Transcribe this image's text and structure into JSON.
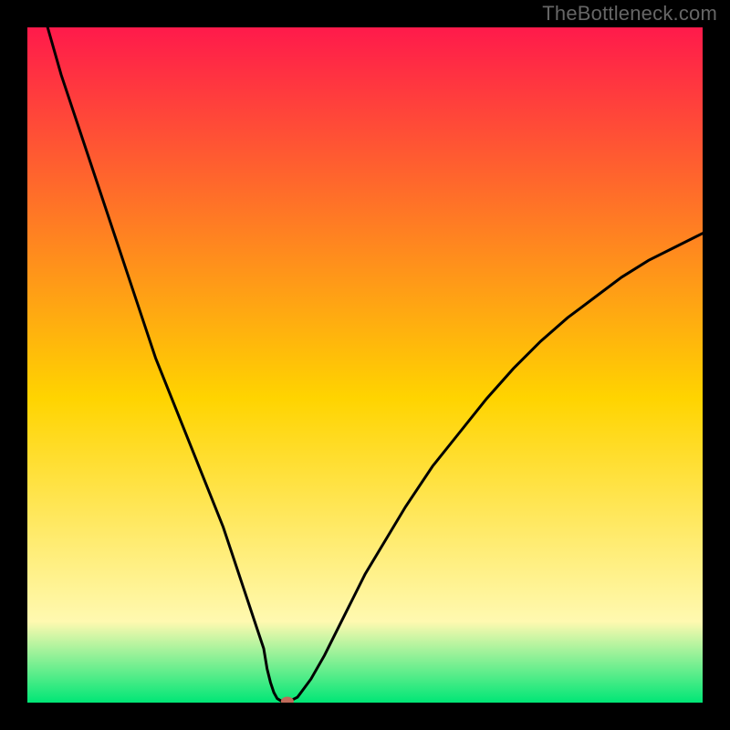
{
  "watermark": "TheBottleneck.com",
  "chart_data": {
    "type": "line",
    "title": "",
    "xlabel": "",
    "ylabel": "",
    "xlim": [
      0,
      100
    ],
    "ylim": [
      0,
      100
    ],
    "background_gradient": {
      "top_color": "#ff1a4b",
      "mid_color": "#ffd400",
      "lower_color": "#fff9b0",
      "bottom_color": "#00e676"
    },
    "series": [
      {
        "name": "bottleneck-curve",
        "color": "#000000",
        "x": [
          3,
          5,
          7,
          9,
          11,
          13,
          15,
          17,
          19,
          21,
          23,
          25,
          27,
          29,
          30,
          31,
          32,
          33,
          34,
          35,
          35.5,
          36,
          36.5,
          37,
          37.5,
          38,
          38.5,
          39,
          40,
          42,
          44,
          46,
          48,
          50,
          53,
          56,
          60,
          64,
          68,
          72,
          76,
          80,
          84,
          88,
          92,
          96,
          100
        ],
        "y": [
          100,
          93,
          87,
          81,
          75,
          69,
          63,
          57,
          51,
          46,
          41,
          36,
          31,
          26,
          23,
          20,
          17,
          14,
          11,
          8,
          5,
          3,
          1.5,
          0.6,
          0.3,
          0,
          0,
          0.3,
          0.8,
          3.5,
          7,
          11,
          15,
          19,
          24,
          29,
          35,
          40,
          45,
          49.5,
          53.5,
          57,
          60,
          63,
          65.5,
          67.5,
          69.5
        ]
      }
    ],
    "marker": {
      "name": "optimal-point",
      "x": 38.5,
      "y": 0.2,
      "color": "#c06a5a"
    }
  }
}
